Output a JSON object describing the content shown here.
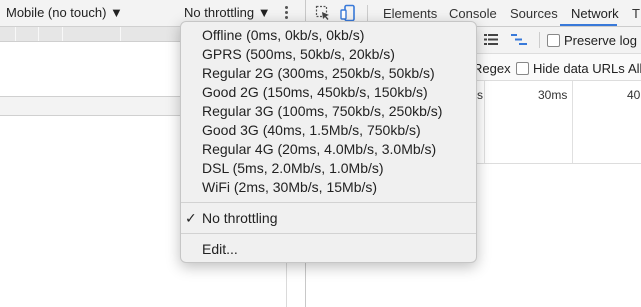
{
  "device_toolbar": {
    "device_select": "Mobile (no touch) ▼",
    "throttle_select": "No throttling ▼"
  },
  "tabs": [
    "Elements",
    "Console",
    "Sources",
    "Network",
    "T"
  ],
  "active_tab": "Network",
  "network_toolbar": {
    "preserve_log": "Preserve log"
  },
  "filter_bar": {
    "regex": "Regex",
    "hide_data_urls": "Hide data URLs",
    "all": "All"
  },
  "timeline": {
    "ticks": [
      "s",
      "30ms",
      "40"
    ]
  },
  "throttle_menu": {
    "presets": [
      "Offline (0ms, 0kb/s, 0kb/s)",
      "GPRS (500ms, 50kb/s, 20kb/s)",
      "Regular 2G (300ms, 250kb/s, 50kb/s)",
      "Good 2G (150ms, 450kb/s, 150kb/s)",
      "Regular 3G (100ms, 750kb/s, 250kb/s)",
      "Good 3G (40ms, 1.5Mb/s, 750kb/s)",
      "Regular 4G (20ms, 4.0Mb/s, 3.0Mb/s)",
      "DSL (5ms, 2.0Mb/s, 1.0Mb/s)",
      "WiFi (2ms, 30Mb/s, 15Mb/s)"
    ],
    "selected_check": "✓",
    "selected": "No throttling",
    "edit": "Edit..."
  },
  "colors": {
    "accent": "#3879d9",
    "menu_bg": "#f0f0f0",
    "toolbar_bg": "#f3f3f3"
  },
  "icons": [
    "inspect-element-icon",
    "device-toggle-icon",
    "kebab-menu-icon",
    "checkmark-icon",
    "list-view-icon",
    "waterfall-icon"
  ]
}
